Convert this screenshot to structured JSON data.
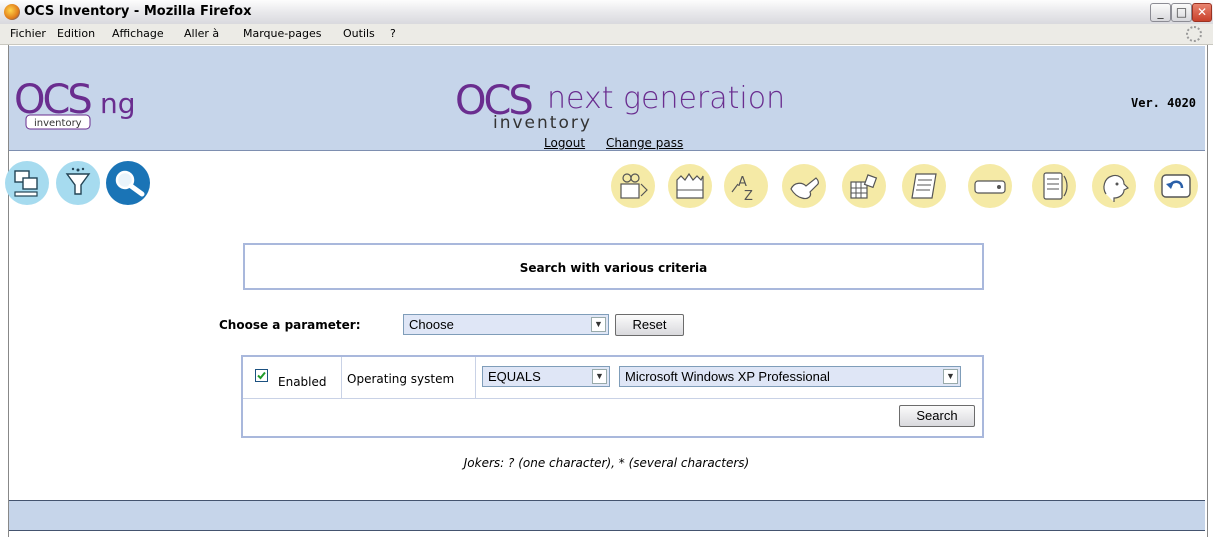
{
  "window": {
    "title": "OCS Inventory - Mozilla Firefox",
    "controls": {
      "minimize": "_",
      "maximize": "□",
      "close": "✕"
    }
  },
  "menu": {
    "items": [
      "Fichier",
      "Edition",
      "Affichage",
      "Aller à",
      "Marque-pages",
      "Outils",
      "?"
    ]
  },
  "header": {
    "logo_small_main": "OCS",
    "logo_small_sub": "inventory",
    "logo_big_main": "OCS",
    "logo_big_next": "next generation",
    "logo_big_sub": "inventory",
    "version": "Ver. 4020",
    "links": {
      "logout": "Logout",
      "change_pass": "Change pass"
    }
  },
  "toolbar": {
    "left_icons": [
      "computers-icon",
      "filter-icon",
      "search-icon"
    ],
    "right_icons": [
      "packages-icon",
      "castle-icon",
      "az-icon",
      "wrench-icon",
      "grid-icon",
      "scroll-icon",
      "drive-icon",
      "document-icon",
      "face-icon",
      "back-icon"
    ]
  },
  "search": {
    "title": "Search with various criteria",
    "parameter_label": "Choose a parameter:",
    "parameter_value": "Choose",
    "reset_label": "Reset",
    "criteria": {
      "enabled_label": "Enabled",
      "enabled_checked": true,
      "field_label": "Operating system",
      "operator_value": "EQUALS",
      "value_value": "Microsoft Windows XP Professional"
    },
    "search_label": "Search",
    "jokers": "Jokers: ? (one character), * (several characters)"
  },
  "colors": {
    "header_bg": "#c6d5ea",
    "box_border": "#a9b8dc",
    "icon_blue": "#a6dbef",
    "icon_yellow": "#f5eaa6",
    "logo_purple": "#6a2d8f"
  }
}
